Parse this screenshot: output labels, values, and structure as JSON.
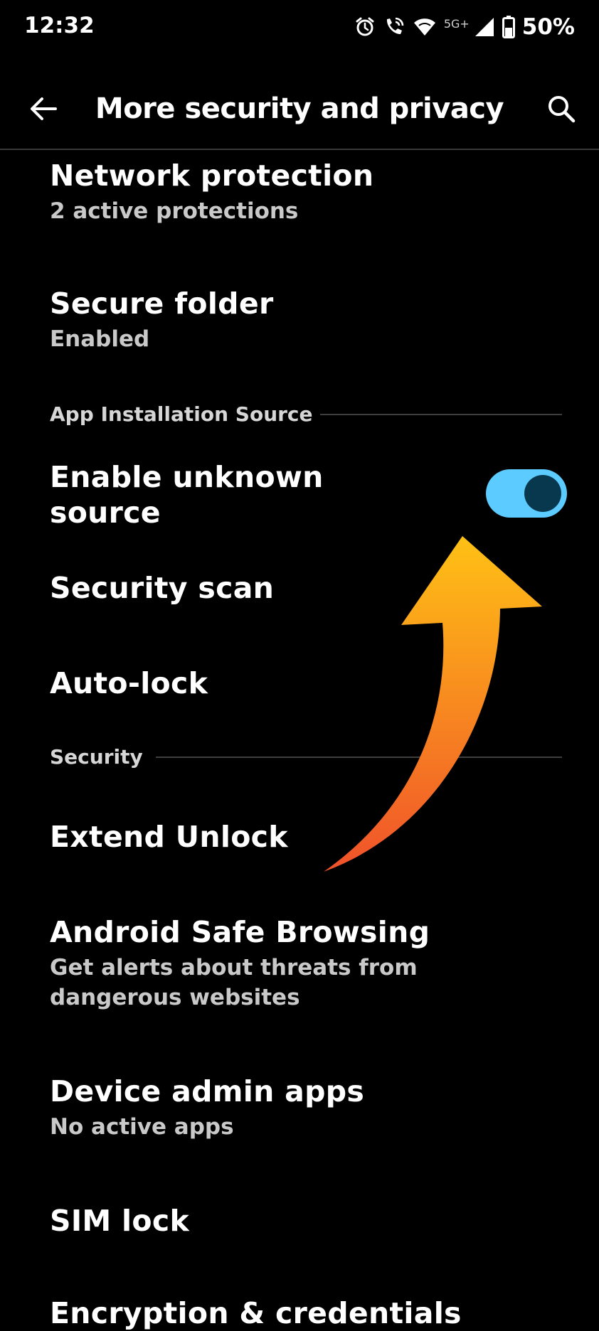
{
  "status_bar": {
    "time": "12:32",
    "network_label": "5G+",
    "battery": "50%",
    "icons": [
      "alarm-icon",
      "wifi-calling-icon",
      "wifi-icon",
      "signal-icon",
      "battery-icon"
    ]
  },
  "app_bar": {
    "title": "More security and privacy",
    "back_icon": "back-arrow-icon",
    "search_icon": "search-icon"
  },
  "items": {
    "network_protection": {
      "title": "Network protection",
      "subtitle": "2 active protections"
    },
    "secure_folder": {
      "title": "Secure folder",
      "subtitle": "Enabled"
    },
    "unknown_source": {
      "title_line1": "Enable unknown",
      "title_line2": "source",
      "toggle_on": true
    },
    "security_scan": {
      "title": "Security scan"
    },
    "auto_lock": {
      "title": "Auto-lock"
    },
    "extend_unlock": {
      "title": "Extend Unlock"
    },
    "safe_browsing": {
      "title": "Android Safe Browsing",
      "subtitle_line1": "Get alerts about threats from",
      "subtitle_line2": "dangerous websites"
    },
    "device_admin": {
      "title": "Device admin apps",
      "subtitle": "No active apps"
    },
    "sim_lock": {
      "title": "SIM lock"
    },
    "encryption": {
      "title": "Encryption & credentials"
    }
  },
  "sections": {
    "app_install": "App Installation Source",
    "security": "Security"
  },
  "colors": {
    "background": "#000000",
    "toggle_track": "#5ccbff",
    "toggle_knob": "#08384d",
    "arrow_top": "#ffc115",
    "arrow_bottom": "#f0522a"
  }
}
